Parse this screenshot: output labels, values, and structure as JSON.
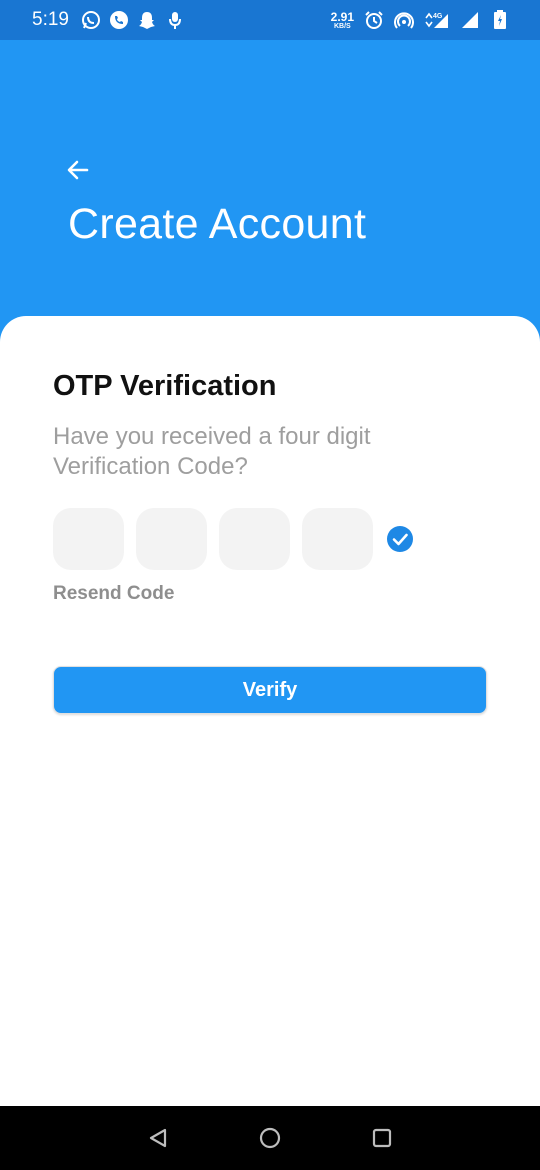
{
  "status_bar": {
    "time": "5:19",
    "net_speed_value": "2.91",
    "net_speed_unit": "KB/S",
    "network_type": "4G",
    "left_icons": [
      "whatsapp-icon",
      "phone-icon",
      "snapchat-icon",
      "mic-icon"
    ],
    "right_icons": [
      "alarm-icon",
      "hotspot-icon",
      "signal-4g-icon",
      "signal-icon",
      "battery-icon"
    ]
  },
  "header": {
    "title": "Create Account",
    "back_icon": "arrow-left-icon"
  },
  "card": {
    "title": "OTP Verification",
    "subtitle": "Have you received a four digit Verification Code?",
    "otp_digits": [
      "",
      "",
      "",
      ""
    ],
    "verified_icon": "check-circle-icon",
    "resend_label": "Resend Code",
    "verify_label": "Verify"
  },
  "nav_bar": {
    "icons": [
      "back-triangle-icon",
      "home-circle-icon",
      "recents-square-icon"
    ]
  },
  "colors": {
    "primary": "#2196f3",
    "status_bar": "#1976d2",
    "otp_box": "#f3f3f3",
    "muted_text": "#9e9e9e"
  }
}
